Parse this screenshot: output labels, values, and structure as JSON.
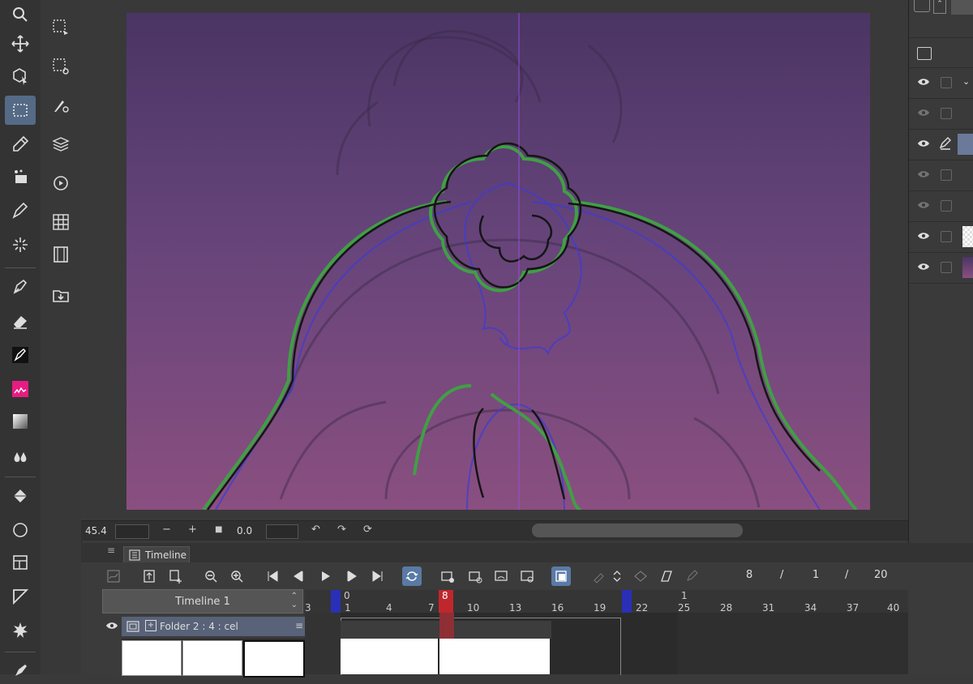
{
  "colors": {
    "accent": "#556a86",
    "playhead": "#c0272d",
    "range_marker": "#2a2fb8",
    "folder_row": "#586278"
  },
  "tools_main": [
    {
      "name": "zoom-icon"
    },
    {
      "name": "move-icon"
    },
    {
      "name": "object-icon"
    },
    {
      "name": "selection-icon",
      "active": true
    },
    {
      "name": "eyedropper-icon"
    },
    {
      "name": "auto-select-icon"
    },
    {
      "name": "pen-icon"
    },
    {
      "name": "magic-wand-icon"
    },
    {
      "name": "fountain-pen-icon"
    },
    {
      "name": "eraser-icon"
    },
    {
      "name": "brush-icon"
    },
    {
      "name": "decoration-icon"
    },
    {
      "name": "gradient-icon"
    },
    {
      "name": "blend-icon"
    },
    {
      "name": "fill-icon"
    },
    {
      "name": "shape-icon"
    },
    {
      "name": "frame-icon"
    },
    {
      "name": "ruler-icon"
    },
    {
      "name": "effect-icon"
    },
    {
      "name": "text-icon"
    }
  ],
  "tools_sub": [
    {
      "name": "lasso-select-icon"
    },
    {
      "name": "select-settings-icon"
    },
    {
      "name": "brush-settings-icon"
    },
    {
      "name": "layer-stack-icon"
    },
    {
      "name": "rotate-view-icon"
    },
    {
      "name": "grid-icon"
    },
    {
      "name": "film-icon"
    },
    {
      "name": "import-icon"
    }
  ],
  "status": {
    "zoom": "45.4",
    "zoom_minus": "−",
    "zoom_plus": "+",
    "stop": "■",
    "rotation": "0.0"
  },
  "timeline": {
    "tab_label": "Timeline",
    "name": "Timeline 1",
    "current_frame": "8",
    "fps": "1",
    "end_frame": "20",
    "sep1": "/",
    "sep2": "/",
    "folder_label": "Folder 2 : 4 : cel",
    "ruler_top": "0",
    "ruler_top2": "1",
    "playhead_label": "8",
    "ruler_ticks": [
      "1",
      "4",
      "7",
      "10",
      "13",
      "16",
      "19",
      "22",
      "25",
      "28",
      "31",
      "34",
      "37",
      "40"
    ],
    "ruler_left": "3"
  }
}
